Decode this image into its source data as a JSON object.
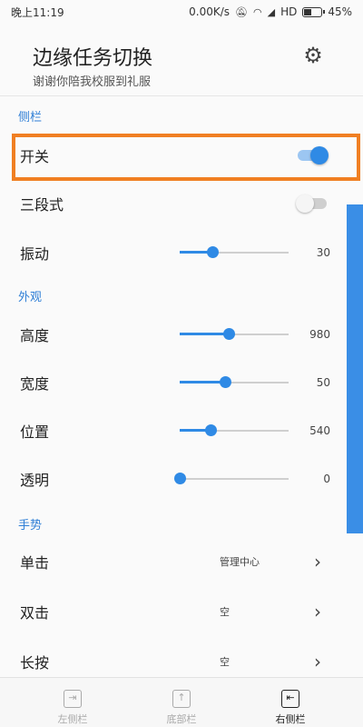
{
  "status_bar": {
    "time": "晚上11:19",
    "network_speed": "0.00K/s",
    "signal_label": "HD",
    "battery_percent": "45%",
    "battery_level": 0.45,
    "icons": [
      "mute-icon",
      "wifi-icon",
      "signal-icon",
      "battery-icon"
    ]
  },
  "header": {
    "title": "边缘任务切换",
    "subtitle": "谢谢你陪我校服到礼服",
    "settings_icon": "gear-icon"
  },
  "sections": {
    "sidebar": {
      "label": "侧栏"
    },
    "appearance": {
      "label": "外观"
    },
    "gesture": {
      "label": "手势"
    }
  },
  "sidebar": {
    "switch": {
      "label": "开关",
      "on": true
    },
    "three_stage": {
      "label": "三段式",
      "on": false
    },
    "vibration": {
      "label": "振动",
      "value": "30",
      "fraction": 0.3
    }
  },
  "appearance": {
    "height": {
      "label": "高度",
      "value": "980",
      "fraction": 0.45
    },
    "width": {
      "label": "宽度",
      "value": "50",
      "fraction": 0.42
    },
    "position": {
      "label": "位置",
      "value": "540",
      "fraction": 0.28
    },
    "opacity": {
      "label": "透明",
      "value": "0",
      "fraction": 0
    }
  },
  "gesture": {
    "tap": {
      "label": "单击",
      "value": "管理中心"
    },
    "double_tap": {
      "label": "双击",
      "value": "空"
    },
    "long_press": {
      "label": "长按",
      "value": "空"
    }
  },
  "bottom_nav": [
    {
      "label": "左侧栏",
      "icon": "left-sidebar-icon",
      "active": false
    },
    {
      "label": "底部栏",
      "icon": "bottom-bar-icon",
      "active": false
    },
    {
      "label": "右侧栏",
      "icon": "right-sidebar-icon",
      "active": true
    }
  ],
  "colors": {
    "accent": "#2f8ae5",
    "highlight": "#f07f22",
    "section_label": "#2f7fd6"
  }
}
